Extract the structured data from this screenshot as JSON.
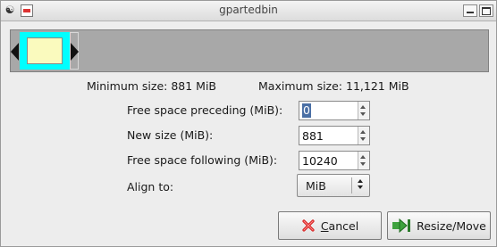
{
  "window": {
    "title": "gpartedbin"
  },
  "sizes": {
    "min_text": "Minimum size: 881 MiB",
    "max_text": "Maximum size: 11,121 MiB"
  },
  "fields": {
    "preceding": {
      "label": "Free space preceding (MiB):",
      "value": "0"
    },
    "new_size": {
      "label": "New size (MiB):",
      "value": "881"
    },
    "following": {
      "label": "Free space following (MiB):",
      "value": "10240"
    },
    "align": {
      "label": "Align to:",
      "value": "MiB"
    }
  },
  "buttons": {
    "cancel_rest": "ancel",
    "cancel_mnemonic": "C",
    "resize_label": "Resize/Move"
  },
  "colors": {
    "partition_fill": "#00ffff",
    "used_space": "#fafabe",
    "free_space": "#a8a8a8"
  }
}
